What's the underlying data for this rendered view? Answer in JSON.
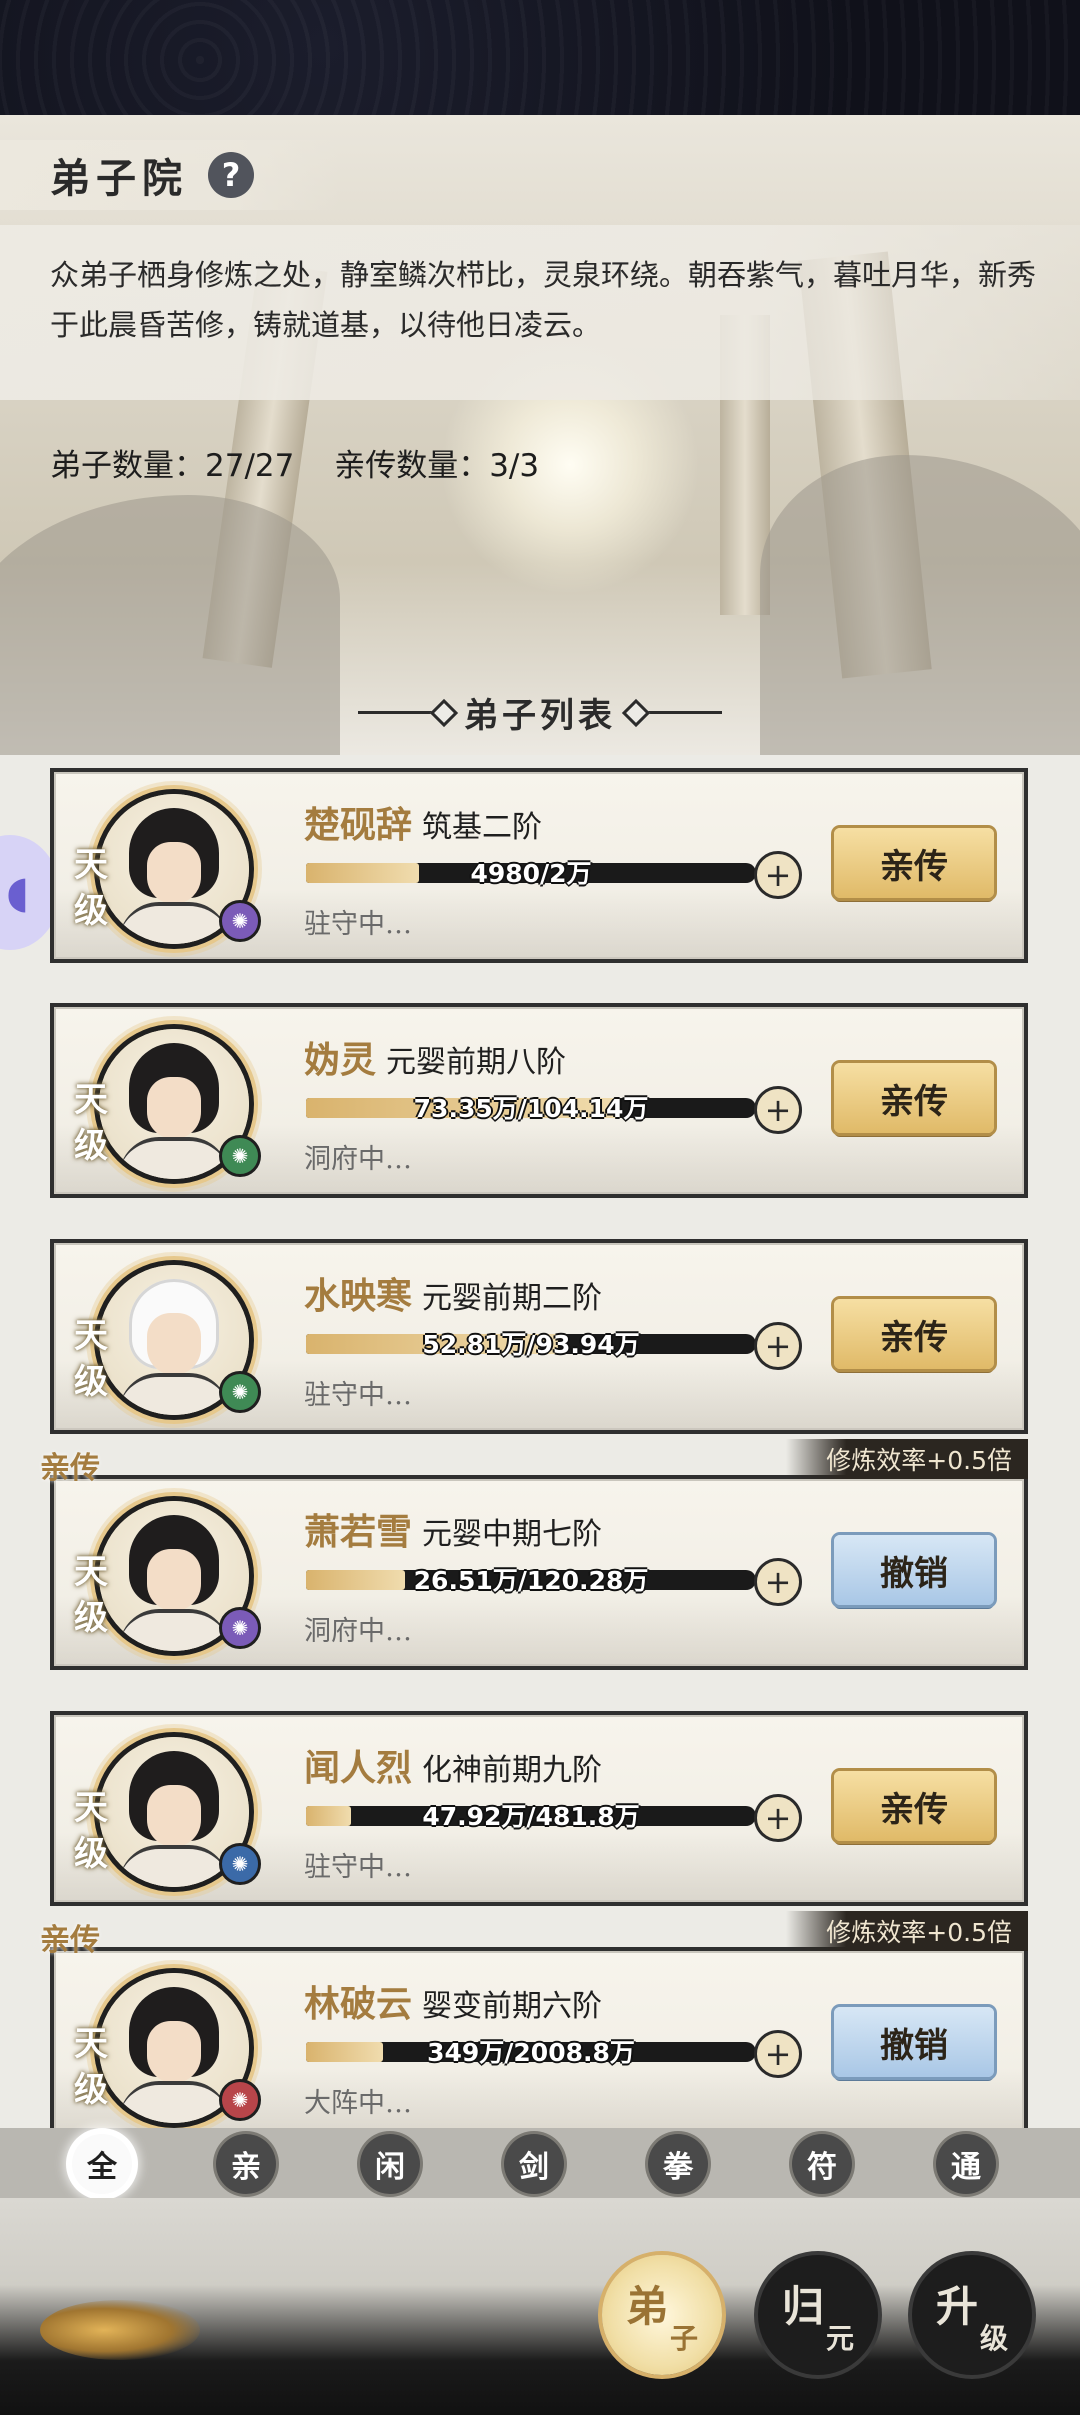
{
  "header": {
    "title": "弟子院",
    "help_icon": "?"
  },
  "description": "众弟子栖身修炼之处，静室鳞次栉比，灵泉环绕。朝吞紫气，暮吐月华，新秀于此晨昏苦修，铸就道基，以待他日凌云。",
  "counts": {
    "disciples": "弟子数量：27/27",
    "personal": "亲传数量：3/3"
  },
  "list_title": "弟子列表",
  "disciples": [
    {
      "grade": "天级",
      "name": "楚砚辞",
      "realm": "筑基二阶",
      "progress_text": "4980/2万",
      "progress": 0.25,
      "status": "驻守中…",
      "action": "亲传",
      "personal": false,
      "element_color": "#7b5bb8"
    },
    {
      "grade": "天级",
      "name": "妫灵",
      "realm": "元婴前期八阶",
      "progress_text": "73.35万/104.14万",
      "progress": 0.7,
      "status": "洞府中…",
      "action": "亲传",
      "personal": false,
      "element_color": "#3f8a55"
    },
    {
      "grade": "天级",
      "name": "水映寒",
      "realm": "元婴前期二阶",
      "progress_text": "52.81万/93.94万",
      "progress": 0.56,
      "status": "驻守中…",
      "action": "亲传",
      "personal": false,
      "element_color": "#3f8a55"
    },
    {
      "grade": "天级",
      "name": "萧若雪",
      "realm": "元婴中期七阶",
      "progress_text": "26.51万/120.28万",
      "progress": 0.22,
      "status": "洞府中…",
      "action": "撤销",
      "personal": true,
      "personal_tag": "亲传",
      "bonus": "修炼效率+0.5倍",
      "element_color": "#7b5bb8"
    },
    {
      "grade": "天级",
      "name": "闻人烈",
      "realm": "化神前期九阶",
      "progress_text": "47.92万/481.8万",
      "progress": 0.1,
      "status": "驻守中…",
      "action": "亲传",
      "personal": false,
      "element_color": "#3b6aa8"
    },
    {
      "grade": "天级",
      "name": "林破云",
      "realm": "婴变前期六阶",
      "progress_text": "349万/2008.8万",
      "progress": 0.17,
      "status": "大阵中…",
      "action": "撤销",
      "personal": true,
      "personal_tag": "亲传",
      "bonus": "修炼效率+0.5倍",
      "element_color": "#b8454a"
    }
  ],
  "filters": [
    "全",
    "亲",
    "闲",
    "剑",
    "拳",
    "符",
    "通"
  ],
  "active_filter": 0,
  "nav": [
    {
      "big": "弟",
      "small": "子",
      "active": true
    },
    {
      "big": "归",
      "small": "元",
      "active": false
    },
    {
      "big": "升",
      "small": "级",
      "active": false
    }
  ],
  "icons": {
    "side_button": "gamepad-icon",
    "help": "question-icon"
  }
}
